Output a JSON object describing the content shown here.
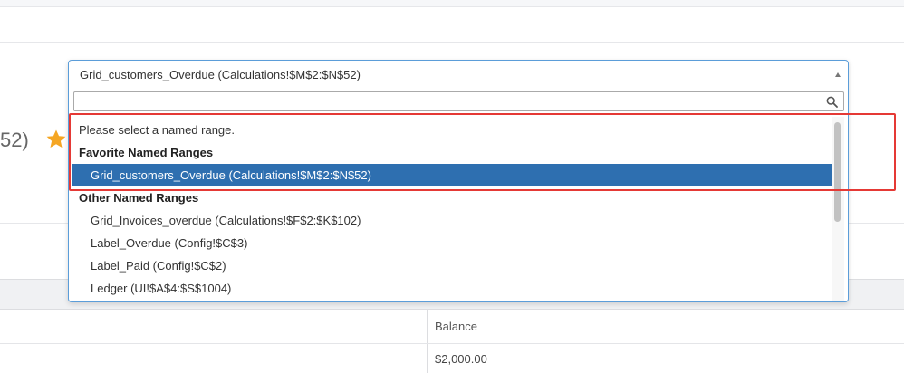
{
  "header": {
    "title_fragment": "52)"
  },
  "select": {
    "current_value": "Grid_customers_Overdue (Calculations!$M$2:$N$52)",
    "search_placeholder": "",
    "hint": "Please select a named range.",
    "groups": [
      {
        "label": "Favorite Named Ranges",
        "items": [
          "Grid_customers_Overdue (Calculations!$M$2:$N$52)"
        ]
      },
      {
        "label": "Other Named Ranges",
        "items": [
          "Grid_Invoices_overdue (Calculations!$F$2:$K$102)",
          "Label_Overdue (Config!$C$3)",
          "Label_Paid (Config!$C$2)",
          "Ledger (UI!$A$4:$S$1004)"
        ]
      }
    ],
    "selected_group": 0,
    "selected_item": 0
  },
  "grid": {
    "column_header": "Balance",
    "cell_value": "$2,000.00"
  },
  "colors": {
    "accent": "#2e6fb0",
    "focus_border": "#5b9dd9",
    "highlight": "#e53935",
    "star": "#f5a623"
  },
  "icons": {
    "favorite": "star-icon",
    "search": "search-icon",
    "caret": "caret-up-icon"
  }
}
